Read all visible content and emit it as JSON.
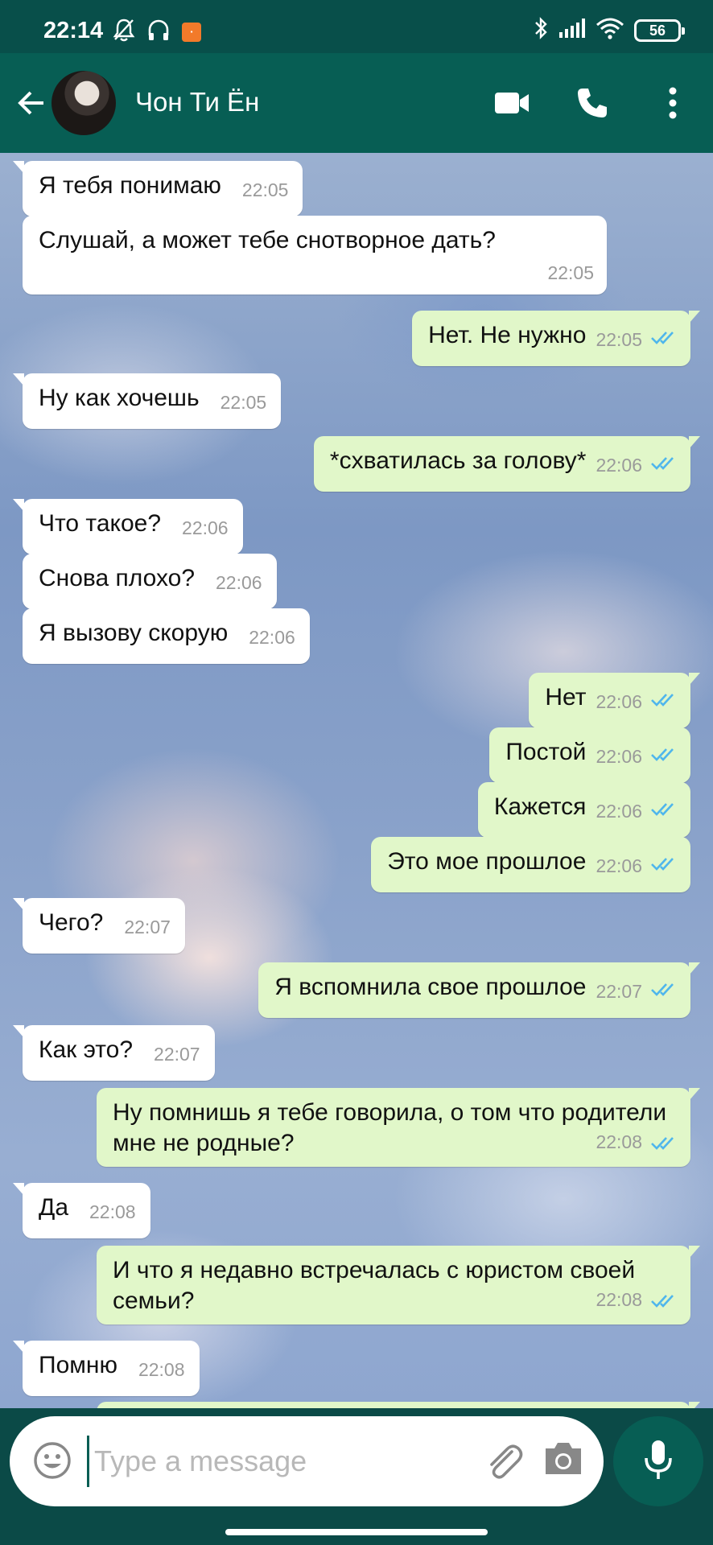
{
  "status_bar": {
    "time": "22:14",
    "battery": "56",
    "icons": [
      "bell-off-icon",
      "headphones-icon",
      "sim-icon",
      "bluetooth-icon",
      "signal-icon",
      "wifi-icon",
      "battery-icon"
    ]
  },
  "header": {
    "contact_name": "Чон Ти Ён",
    "icons": [
      "back-arrow-icon",
      "video-call-icon",
      "voice-call-icon",
      "more-vertical-icon"
    ]
  },
  "messages": [
    {
      "dir": "in",
      "text": "Я тебя понимаю",
      "time": "22:05"
    },
    {
      "dir": "in",
      "text": "Слушай, а может тебе снотворное дать?",
      "time": "22:05"
    },
    {
      "dir": "out",
      "text": "Нет. Не нужно",
      "time": "22:05"
    },
    {
      "dir": "in",
      "text": "Ну как хочешь",
      "time": "22:05"
    },
    {
      "dir": "out",
      "text": "*схватилась за голову*",
      "time": "22:06"
    },
    {
      "dir": "in",
      "text": "Что такое?",
      "time": "22:06"
    },
    {
      "dir": "in",
      "text": "Снова плохо?",
      "time": "22:06"
    },
    {
      "dir": "in",
      "text": "Я вызову скорую",
      "time": "22:06"
    },
    {
      "dir": "out",
      "text": "Нет",
      "time": "22:06"
    },
    {
      "dir": "out",
      "text": "Постой",
      "time": "22:06"
    },
    {
      "dir": "out",
      "text": "Кажется",
      "time": "22:06"
    },
    {
      "dir": "out",
      "text": "Это мое прошлое",
      "time": "22:06"
    },
    {
      "dir": "in",
      "text": "Чего?",
      "time": "22:07"
    },
    {
      "dir": "out",
      "text": "Я вспомнила свое прошлое",
      "time": "22:07"
    },
    {
      "dir": "in",
      "text": "Как это?",
      "time": "22:07"
    },
    {
      "dir": "out",
      "text": "Ну помнишь я тебе говорила, о том что родители мне не родные?",
      "time": "22:08"
    },
    {
      "dir": "in",
      "text": "Да",
      "time": "22:08"
    },
    {
      "dir": "out",
      "text": "И что я недавно встречалась с юристом своей семьи?",
      "time": "22:08"
    },
    {
      "dir": "in",
      "text": "Помню",
      "time": "22:08"
    }
  ],
  "input": {
    "placeholder": "Type a message"
  },
  "colors": {
    "header": "#075e54",
    "status_bar": "#084f4a",
    "outgoing_bubble": "#e1f7c9",
    "incoming_bubble": "#ffffff",
    "read_ticks": "#4fb6ec"
  }
}
